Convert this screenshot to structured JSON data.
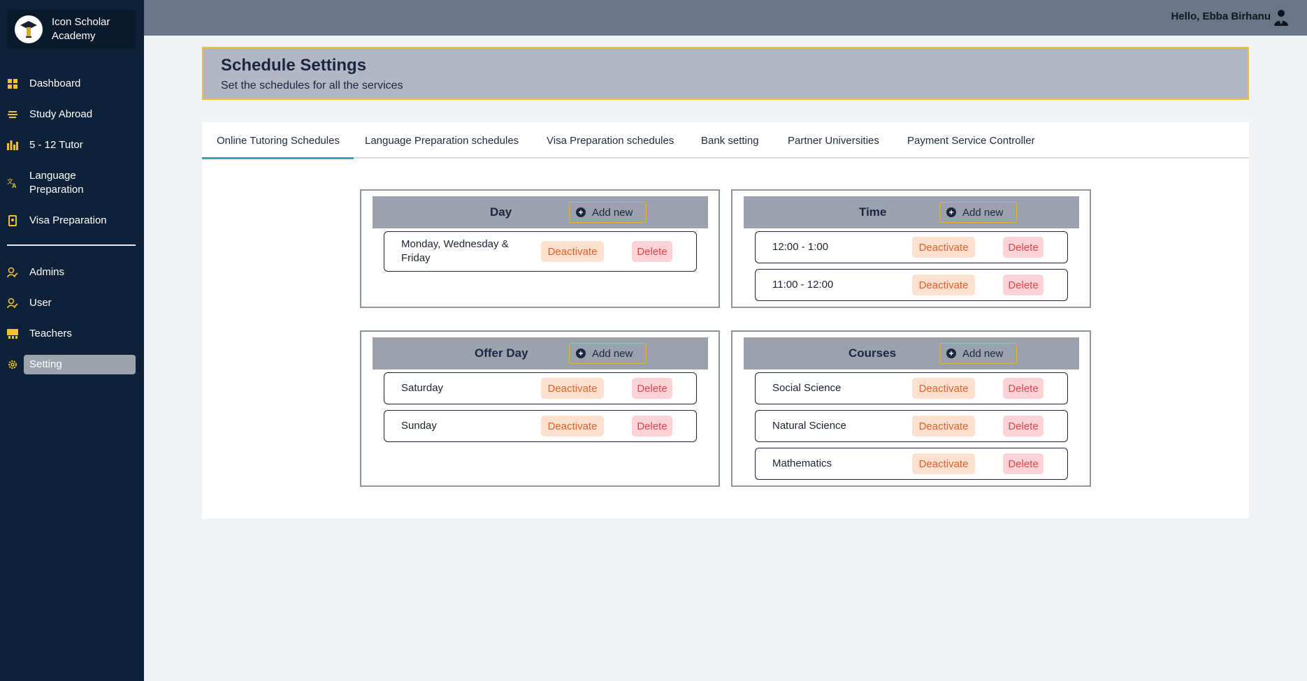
{
  "brand": {
    "name": "Icon Scholar Academy"
  },
  "sidebar": {
    "items": [
      {
        "label": "Dashboard",
        "icon": "dashboard-icon"
      },
      {
        "label": "Study Abroad",
        "icon": "study-abroad-icon"
      },
      {
        "label": "5 - 12 Tutor",
        "icon": "bar-chart-icon"
      },
      {
        "label": "Language Preparation",
        "icon": "translate-icon"
      },
      {
        "label": "Visa Preparation",
        "icon": "passport-icon"
      },
      {
        "label": "Admins",
        "icon": "user-edit-icon"
      },
      {
        "label": "User",
        "icon": "user-edit-icon"
      },
      {
        "label": "Teachers",
        "icon": "teacher-board-icon"
      },
      {
        "label": "Setting",
        "icon": "gear-icon",
        "active": true
      }
    ]
  },
  "topbar": {
    "greeting": "Hello, Ebba Birhanu",
    "icon": "user-icon"
  },
  "header": {
    "title": "Schedule Settings",
    "subtitle": "Set the schedules for all the services"
  },
  "tabs": [
    {
      "label": "Online Tutoring Schedules",
      "active": true
    },
    {
      "label": "Language Preparation schedules"
    },
    {
      "label": "Visa Preparation schedules"
    },
    {
      "label": "Bank setting"
    },
    {
      "label": "Partner Universities"
    },
    {
      "label": "Payment Service Controller"
    }
  ],
  "buttons": {
    "add_new": "Add new",
    "deactivate": "Deactivate",
    "delete": "Delete"
  },
  "panels": {
    "day": {
      "title": "Day",
      "items": [
        "Monday, Wednesday & Friday"
      ]
    },
    "time": {
      "title": "Time",
      "items": [
        "12:00 - 1:00",
        "11:00 - 12:00"
      ]
    },
    "offer_day": {
      "title": "Offer Day",
      "items": [
        "Saturday",
        "Sunday"
      ]
    },
    "courses": {
      "title": "Courses",
      "items": [
        "Social Science",
        "Natural Science",
        "Mathematics"
      ]
    }
  },
  "colors": {
    "sidebar_bg": "#0f2138",
    "accent_yellow": "#f2c12e",
    "tab_underline": "#3aa3b9",
    "deactivate_text": "#e2602a",
    "delete_text": "#e0454d"
  }
}
